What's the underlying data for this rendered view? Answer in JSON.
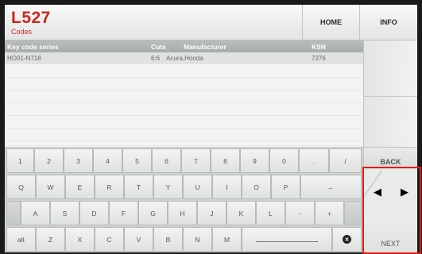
{
  "header": {
    "title": "L527",
    "subtitle": "Codes",
    "home_label": "HOME",
    "info_label": "INFO"
  },
  "table": {
    "columns": [
      "Key code series",
      "Cuts",
      "Manufacturer",
      "KSN"
    ],
    "rows": [
      {
        "series": "HO01-N718",
        "cuts": "6:6",
        "manufacturer": "Acura,Honda",
        "ksn": "7276"
      }
    ]
  },
  "nav": {
    "back_label": "BACK",
    "next_label": "NEXT",
    "left_arrow": "◀",
    "right_arrow": "▶"
  },
  "keyboard": {
    "row1": [
      "1",
      "2",
      "3",
      "4",
      "5",
      "6",
      "7",
      "8",
      "9",
      "0",
      ".",
      "/"
    ],
    "row2": [
      "Q",
      "W",
      "E",
      "R",
      "T",
      "Y",
      "U",
      "I",
      "O",
      "P",
      "←"
    ],
    "row3": [
      "A",
      "S",
      "D",
      "F",
      "G",
      "H",
      "J",
      "K",
      "L",
      "-",
      "+"
    ],
    "row4": [
      "alt",
      "Z",
      "X",
      "C",
      "V",
      "B",
      "N",
      "M"
    ],
    "clear_symbol": "✕"
  },
  "colors": {
    "accent_red": "#c8281e",
    "highlight_red": "#e21c17"
  }
}
